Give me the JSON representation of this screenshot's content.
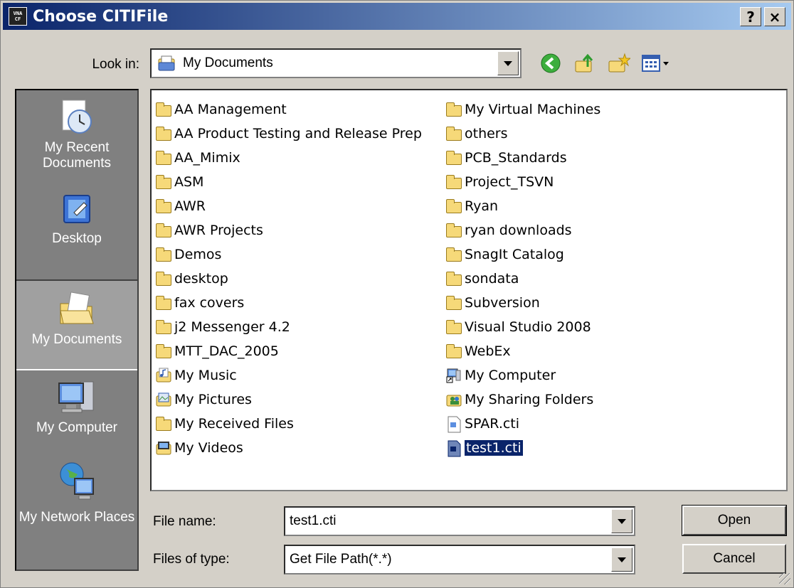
{
  "window": {
    "title": "Choose CITIFile",
    "icon_text": [
      "VNA",
      "CF"
    ],
    "help_label": "?",
    "close_label": "×"
  },
  "lookin": {
    "label": "Look in:",
    "value": "My Documents"
  },
  "toolbar": {
    "icons": [
      "back-icon",
      "up-folder-icon",
      "new-folder-icon",
      "view-menu-icon"
    ]
  },
  "places": [
    {
      "label": "My Recent Documents",
      "icon": "recent-documents-icon"
    },
    {
      "label": "Desktop",
      "icon": "desktop-icon"
    },
    {
      "label": "My Documents",
      "icon": "my-documents-icon",
      "selected": true
    },
    {
      "label": "My Computer",
      "icon": "my-computer-icon"
    },
    {
      "label": "My Network Places",
      "icon": "network-places-icon"
    }
  ],
  "files": {
    "col1": [
      {
        "name": "AA Management",
        "icon": "folder-icon"
      },
      {
        "name": "AA Product Testing and Release Prep",
        "icon": "folder-icon"
      },
      {
        "name": "AA_Mimix",
        "icon": "folder-icon"
      },
      {
        "name": "ASM",
        "icon": "folder-icon"
      },
      {
        "name": "AWR",
        "icon": "folder-icon"
      },
      {
        "name": "AWR Projects",
        "icon": "folder-icon"
      },
      {
        "name": "Demos",
        "icon": "folder-icon"
      },
      {
        "name": "desktop",
        "icon": "folder-icon"
      },
      {
        "name": "fax covers",
        "icon": "folder-icon"
      },
      {
        "name": "j2 Messenger 4.2",
        "icon": "folder-icon"
      },
      {
        "name": "MTT_DAC_2005",
        "icon": "folder-icon"
      },
      {
        "name": "My Music",
        "icon": "music-folder-icon"
      },
      {
        "name": "My Pictures",
        "icon": "pictures-folder-icon"
      },
      {
        "name": "My Received Files",
        "icon": "folder-icon"
      },
      {
        "name": "My Videos",
        "icon": "videos-folder-icon"
      }
    ],
    "col2": [
      {
        "name": "My Virtual Machines",
        "icon": "folder-icon"
      },
      {
        "name": "others",
        "icon": "folder-icon"
      },
      {
        "name": "PCB_Standards",
        "icon": "folder-icon"
      },
      {
        "name": "Project_TSVN",
        "icon": "folder-icon"
      },
      {
        "name": "Ryan",
        "icon": "folder-icon"
      },
      {
        "name": "ryan downloads",
        "icon": "folder-icon"
      },
      {
        "name": "SnagIt Catalog",
        "icon": "folder-icon"
      },
      {
        "name": "sondata",
        "icon": "folder-icon"
      },
      {
        "name": "Subversion",
        "icon": "folder-icon"
      },
      {
        "name": "Visual Studio 2008",
        "icon": "folder-icon"
      },
      {
        "name": "WebEx",
        "icon": "folder-icon"
      },
      {
        "name": "My Computer",
        "icon": "my-computer-shortcut-icon"
      },
      {
        "name": "My Sharing Folders",
        "icon": "sharing-folders-icon"
      },
      {
        "name": "SPAR.cti",
        "icon": "file-icon"
      },
      {
        "name": "test1.cti",
        "icon": "file-icon",
        "selected": true
      }
    ]
  },
  "filename": {
    "label": "File name:",
    "value": "test1.cti"
  },
  "filetype": {
    "label": "Files of type:",
    "value": "Get File Path(*.*)"
  },
  "buttons": {
    "open": "Open",
    "cancel": "Cancel"
  }
}
